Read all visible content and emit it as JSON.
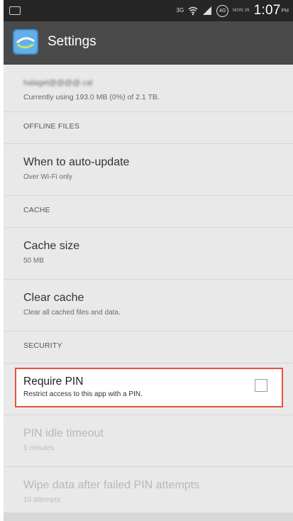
{
  "status_bar": {
    "network_label": "3G",
    "battery_level": "4G",
    "date": "MON 26",
    "time": "1:07",
    "ampm": "PM"
  },
  "action_bar": {
    "title": "Settings",
    "app_icon": "app-icon"
  },
  "account": {
    "name": "halagel@@@@.cal",
    "usage": "Currently using 193.0 MB (0%) of 2.1 TB."
  },
  "sections": {
    "offline_files": "OFFLINE FILES",
    "cache": "CACHE",
    "security": "SECURITY"
  },
  "prefs": {
    "auto_update": {
      "title": "When to auto-update",
      "summary": "Over Wi-Fi only"
    },
    "cache_size": {
      "title": "Cache size",
      "summary": "50 MB"
    },
    "clear_cache": {
      "title": "Clear cache",
      "summary": "Clear all cached files and data."
    },
    "require_pin": {
      "title": "Require PIN",
      "summary": "Restrict access to this app with a PIN.",
      "checked": false
    },
    "pin_timeout": {
      "title": "PIN idle timeout",
      "summary": "5 minutes"
    },
    "wipe_data": {
      "title": "Wipe data after failed PIN attempts",
      "summary": "10 attempts"
    }
  },
  "colors": {
    "highlight_border": "#e8503e",
    "action_bar": "#4a4a4a",
    "status_bar": "#262626",
    "list_background": "#e9e9e9"
  }
}
